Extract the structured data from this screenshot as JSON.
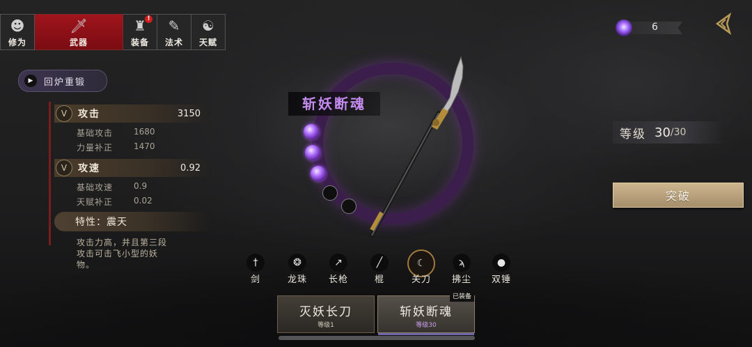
{
  "nav": {
    "tabs": [
      {
        "label": "修为",
        "icon": "cultivator-icon"
      },
      {
        "label": "武器",
        "icon": "sword-icon"
      },
      {
        "label": "装备",
        "icon": "armor-icon",
        "badge": "!"
      },
      {
        "label": "法术",
        "icon": "scroll-icon"
      },
      {
        "label": "天赋",
        "icon": "taiji-icon"
      }
    ],
    "active": "武器"
  },
  "currency": {
    "value": "6",
    "icon": "spirit-gem-icon"
  },
  "reforge": {
    "label": "回炉重锻"
  },
  "stats": {
    "attack": {
      "label": "攻击",
      "value": "3150",
      "subs": [
        {
          "label": "基础攻击",
          "value": "1680"
        },
        {
          "label": "力量补正",
          "value": "1470"
        }
      ]
    },
    "speed": {
      "label": "攻速",
      "value": "0.92",
      "subs": [
        {
          "label": "基础攻速",
          "value": "0.9"
        },
        {
          "label": "天赋补正",
          "value": "0.02"
        }
      ]
    },
    "trait": {
      "label": "特性：震天"
    },
    "description": "攻击力高，并且第三段攻击可击飞小型的妖物。"
  },
  "weapon": {
    "name": "斩妖断魂",
    "orbs": [
      true,
      true,
      true,
      false,
      false
    ],
    "ring_color": "#3b1e4c",
    "name_color": "#c58bf0"
  },
  "level": {
    "label": "等级",
    "current": "30",
    "max": "/30"
  },
  "breakthrough": {
    "label": "突破"
  },
  "weapon_types": [
    {
      "label": "剑",
      "icon": "sword-icon"
    },
    {
      "label": "龙珠",
      "icon": "dragon-icon"
    },
    {
      "label": "长枪",
      "icon": "spear-icon"
    },
    {
      "label": "棍",
      "icon": "staff-icon"
    },
    {
      "label": "关刀",
      "icon": "glaive-icon",
      "selected": true
    },
    {
      "label": "拂尘",
      "icon": "whisk-icon"
    },
    {
      "label": "双锤",
      "icon": "hammer-icon"
    }
  ],
  "cards": [
    {
      "name": "灭妖长刀",
      "level": "等级1"
    },
    {
      "name": "斩妖断魂",
      "level": "等级30",
      "tag": "已装备",
      "equipped": true
    }
  ]
}
